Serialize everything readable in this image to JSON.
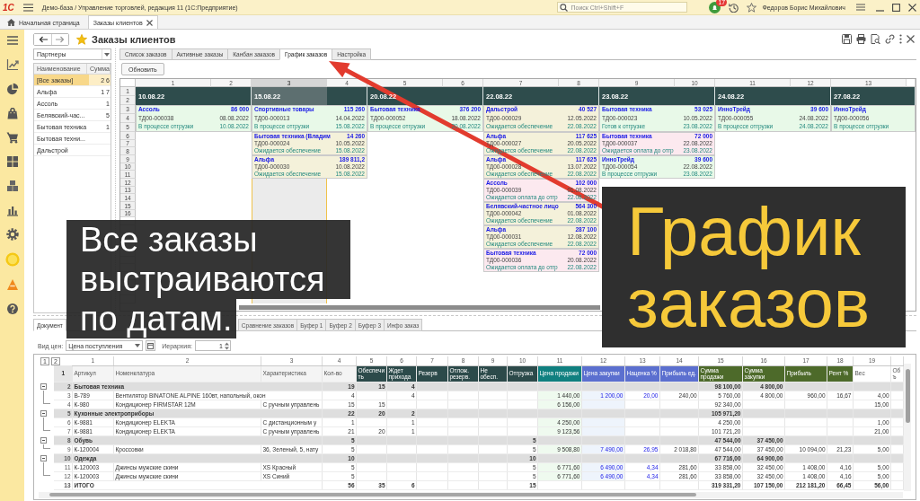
{
  "title_bar": {
    "logo": "1С",
    "title": "Демо-база / Управление торговлей, редакция 11 (1С:Предприятие)",
    "search": {
      "placeholder": "Поиск Ctrl+Shift+F"
    },
    "badge": "17",
    "user": "Федоров Борис Михайлович"
  },
  "window_tabs": [
    {
      "kind": "home",
      "label": "Начальная страница",
      "selected": false
    },
    {
      "kind": "document",
      "label": "Заказы клиентов",
      "selected": true
    }
  ],
  "form": {
    "title": "Заказы клиентов",
    "favorite": true
  },
  "partners": {
    "filter": "Партнеры",
    "columns": [
      "Наименование",
      "Сумма"
    ],
    "rows": [
      {
        "name": "[Все заказы]",
        "sum": "2 6",
        "selected": true
      },
      {
        "name": "Альфа",
        "sum": "1 7",
        "selected": false
      },
      {
        "name": "Ассоль",
        "sum": "1",
        "selected": false
      },
      {
        "name": "Белявский-час...",
        "sum": "5",
        "selected": false
      },
      {
        "name": "Бытовая техника",
        "sum": "1",
        "selected": false
      },
      {
        "name": "Бытовая техни...",
        "selected": false
      },
      {
        "name": "Дальстрой",
        "selected": false
      }
    ]
  },
  "view_tabs": [
    {
      "label": "Список заказов",
      "selected": false
    },
    {
      "label": "Активные заказы",
      "selected": false
    },
    {
      "label": "Канбан заказов",
      "selected": false
    },
    {
      "label": "График заказов",
      "selected": true
    },
    {
      "label": "Настройка",
      "selected": false
    }
  ],
  "refresh_button": "Обновить",
  "schedule": {
    "columns": [
      {
        "label": "1",
        "selected": false
      },
      {
        "label": "2",
        "selected": false
      },
      {
        "label": "3",
        "selected": true
      },
      {
        "label": "4",
        "selected": false
      },
      {
        "label": "5",
        "selected": false
      },
      {
        "label": "6",
        "selected": false
      },
      {
        "label": "7",
        "selected": false
      },
      {
        "label": "8",
        "selected": false
      },
      {
        "label": "9",
        "selected": false
      },
      {
        "label": "10",
        "selected": false
      },
      {
        "label": "11",
        "selected": false
      },
      {
        "label": "12",
        "selected": false
      },
      {
        "label": "13",
        "selected": false
      }
    ],
    "row_numbers": [
      "1",
      "2",
      "3",
      "4",
      "5",
      "6",
      "7",
      "8",
      "9",
      "10",
      "11",
      "12",
      "13",
      "14",
      "15",
      "16"
    ],
    "days": [
      {
        "date": "10.08.22",
        "orders": [
          {
            "customer": "Ассоль",
            "amount": "86 000",
            "number": "ТД00-000038",
            "date": "08.08.2022",
            "status": "В процессе отгрузки",
            "ship_date": "10.08.2022",
            "color": "#e8f9e8"
          }
        ]
      },
      {
        "date": "15.08.22",
        "orders": [
          {
            "customer": "Спортивные товары",
            "amount": "115 260",
            "number": "ТД00-000013",
            "date": "14.04.2022",
            "status": "В процессе отгрузки",
            "ship_date": "15.08.2022",
            "color": "#e8f9e8"
          },
          {
            "customer": "Бытовая техника (Владим",
            "amount": "14 260",
            "number": "ТД00-000024",
            "date": "10.05.2022",
            "status": "Ожидается обеспечение",
            "ship_date": "15.08.2022",
            "color": "#f4f1da"
          },
          {
            "customer": "Альфа",
            "amount": "189 811,2",
            "number": "ТД00-000030",
            "date": "10.08.2022",
            "status": "Ожидается обеспечение",
            "ship_date": "15.08.2022",
            "color": "#f4f1da"
          }
        ]
      },
      {
        "date": "20.08.22",
        "orders": [
          {
            "customer": "Бытовая техника",
            "amount": "376 200",
            "number": "ТД00-000052",
            "date": "18.08.2022",
            "status": "В процессе отгрузки",
            "ship_date": "20.08.2022",
            "color": "#e8f9e8"
          }
        ]
      },
      {
        "date": "22.08.22",
        "orders": [
          {
            "customer": "Дальстрой",
            "amount": "40 527",
            "number": "ТД00-000029",
            "date": "12.05.2022",
            "status": "Ожидается обеспечение",
            "ship_date": "22.08.2022",
            "color": "#f4f1da"
          },
          {
            "customer": "Альфа",
            "amount": "117 625",
            "number": "ТД00-000027",
            "date": "20.05.2022",
            "status": "Ожидается обеспечение",
            "ship_date": "22.08.2022",
            "color": "#f4f1da"
          },
          {
            "customer": "Альфа",
            "amount": "117 625",
            "number": "ТД00-000028",
            "date": "13.07.2022",
            "status": "Ожидается обеспечение",
            "ship_date": "22.08.2022",
            "color": "#f4f1da"
          },
          {
            "customer": "Ассоль",
            "amount": "102 000",
            "number": "ТД00-000039",
            "date": "01.08.2022",
            "status": "Ожидается оплата до отгр",
            "ship_date": "22.08.2022",
            "color": "#fce9ef"
          },
          {
            "customer": "Белявский-частное лицо",
            "amount": "564 300",
            "number": "ТД00-000042",
            "date": "01.08.2022",
            "status": "Ожидается обеспечение",
            "ship_date": "22.08.2022",
            "color": "#f4f1da"
          },
          {
            "customer": "Альфа",
            "amount": "287 100",
            "number": "ТД00-000031",
            "date": "12.08.2022",
            "status": "Ожидается обеспечение",
            "ship_date": "22.08.2022",
            "color": "#f4f1da"
          },
          {
            "customer": "Бытовая техника",
            "amount": "72 000",
            "number": "ТД00-000036",
            "date": "20.08.2022",
            "status": "Ожидается оплата до отгр",
            "ship_date": "22.08.2022",
            "color": "#fce9ef"
          }
        ]
      },
      {
        "date": "23.08.22",
        "orders": [
          {
            "customer": "Бытовая техника",
            "amount": "53 025",
            "number": "ТД00-000023",
            "date": "10.05.2022",
            "status": "Готов к отгрузке",
            "ship_date": "23.08.2022",
            "color": "#e8f9e8"
          },
          {
            "customer": "Бытовая техника",
            "amount": "72 000",
            "number": "ТД00-000037",
            "date": "22.08.2022",
            "status": "Ожидается оплата до отгр",
            "ship_date": "23.08.2022",
            "color": "#fce9ef"
          },
          {
            "customer": "ИнноТрейд",
            "amount": "39 600",
            "number": "ТД00-000054",
            "date": "22.08.2022",
            "status": "В процессе отгрузки",
            "ship_date": "23.08.2022",
            "color": "#e8f9e8"
          }
        ]
      },
      {
        "date": "24.08.22",
        "orders": [
          {
            "customer": "ИнноТрейд",
            "amount": "39 600",
            "number": "ТД00-000055",
            "date": "24.08.2022",
            "status": "В процессе отгрузки",
            "ship_date": "24.08.2022",
            "color": "#e8f9e8"
          }
        ]
      },
      {
        "date": "27.08.22",
        "orders": [
          {
            "customer": "ИнноТрейд",
            "number": "ТД00-000056",
            "status": "В процессе отгрузки",
            "color": "#e8f9e8"
          }
        ]
      }
    ]
  },
  "details": {
    "tabs": [
      {
        "label": "Документ",
        "selected": true
      },
      {
        "label": "Сравнение заказов",
        "selected": false
      },
      {
        "label": "Буфер 1",
        "selected": false
      },
      {
        "label": "Буфер 2",
        "selected": false
      },
      {
        "label": "Буфер 3",
        "selected": false
      },
      {
        "label": "Инфо заказ",
        "selected": false
      }
    ],
    "price_type": {
      "label": "Вид цен:",
      "value": "Цена поступления"
    },
    "hierarchy": {
      "label": "Иерархия:",
      "value": "1"
    },
    "table": {
      "levels": [
        "1",
        "2"
      ],
      "header_number": "1",
      "columns": [
        {
          "number": "1",
          "label": "Артикул",
          "color": "#f4f4f4"
        },
        {
          "number": "2",
          "label": "Номенклатура",
          "color": "#f4f4f4"
        },
        {
          "number": "3",
          "label": "Характеристика",
          "color": "#f4f4f4"
        },
        {
          "number": "4",
          "label": "Кол-во",
          "color": "#f4f4f4"
        },
        {
          "number": "5",
          "label": "Обеспечить",
          "color": "#2c4a4a"
        },
        {
          "number": "6",
          "label": "Ждет прихода",
          "color": "#2c4a4a"
        },
        {
          "number": "7",
          "label": "Резерв",
          "color": "#2c4a4a"
        },
        {
          "number": "8",
          "label": "Отлож. резерв.",
          "color": "#2c4a4a"
        },
        {
          "number": "9",
          "label": "Не обесп.",
          "color": "#2c4a4a"
        },
        {
          "number": "10",
          "label": "Отгрузка",
          "color": "#2c4a4a"
        },
        {
          "number": "11",
          "label": "Цена продажи",
          "color": "#108080"
        },
        {
          "number": "12",
          "label": "Цена закупки",
          "color": "#5b6fcf"
        },
        {
          "number": "13",
          "label": "Наценка %",
          "color": "#5b6fcf"
        },
        {
          "number": "14",
          "label": "Прибыль ед.",
          "color": "#5b6fcf"
        },
        {
          "number": "15",
          "label": "Сумма продажи",
          "color": "#4d6a2a"
        },
        {
          "number": "16",
          "label": "Сумма закупки",
          "color": "#4d6a2a"
        },
        {
          "number": "17",
          "label": "Прибыль",
          "color": "#4d6a2a"
        },
        {
          "number": "18",
          "label": "Рент %",
          "color": "#4d6a2a"
        },
        {
          "number": "19",
          "label": "Вес",
          "color": "#ffffff"
        },
        {
          "label": "Объ",
          "color": "#ffffff"
        }
      ],
      "rows": [
        {
          "number": "2",
          "kind": "group",
          "expanded": true,
          "cells": [
            {
              "text": "Бытовая техника",
              "colspan": 3
            },
            "19",
            "15",
            "4",
            null,
            null,
            null,
            null,
            null,
            null,
            null,
            null,
            "98 100,00",
            "4 800,00"
          ]
        },
        {
          "number": "3",
          "kind": "item",
          "cells": [
            "В-789",
            {
              "text": "Вентилятор BINATONE ALPINE 160вт, напольный, окон",
              "colspan": 2
            },
            "4",
            null,
            "4",
            null,
            null,
            null,
            null,
            "1 440,00",
            "1 200,00",
            "20,00",
            "240,00",
            "5 760,00",
            "4 800,00",
            "960,00",
            "16,67",
            "4,00"
          ]
        },
        {
          "number": "4",
          "kind": "item",
          "cells": [
            "К-980",
            "Кондиционер FIRMSTAR 12M",
            "С ручным управлень",
            "15",
            "15",
            null,
            null,
            null,
            null,
            null,
            "6 156,00",
            null,
            null,
            null,
            "92 340,00",
            null,
            null,
            null,
            "15,00"
          ]
        },
        {
          "number": "5",
          "kind": "group",
          "expanded": true,
          "cells": [
            {
              "text": "Кухонные электроприборы",
              "colspan": 3
            },
            "22",
            "20",
            "2",
            null,
            null,
            null,
            null,
            null,
            null,
            null,
            null,
            "105 971,20"
          ]
        },
        {
          "number": "6",
          "kind": "item",
          "cells": [
            "К-9881",
            "Кондиционер ELEKTA",
            "С дистанционным у",
            "1",
            null,
            "1",
            null,
            null,
            null,
            null,
            "4 250,00",
            null,
            null,
            null,
            "4 250,00",
            null,
            null,
            null,
            "1,00"
          ]
        },
        {
          "number": "7",
          "kind": "item",
          "cells": [
            "К-9881",
            "Кондиционер ELEKTA",
            "С ручным управлень",
            "21",
            "20",
            "1",
            null,
            null,
            null,
            null,
            "9 123,56",
            null,
            null,
            null,
            "101 721,20",
            null,
            null,
            null,
            "21,00"
          ]
        },
        {
          "number": "8",
          "kind": "group",
          "expanded": true,
          "cells": [
            {
              "text": "Обувь",
              "colspan": 3
            },
            "5",
            null,
            null,
            null,
            null,
            null,
            "5",
            null,
            null,
            null,
            null,
            "47 544,00",
            "37 450,00"
          ]
        },
        {
          "number": "9",
          "kind": "item",
          "cells": [
            "К-120004",
            "Кроссовки",
            "36, Зеленый, 5, нату",
            "5",
            null,
            null,
            null,
            null,
            null,
            "5",
            "9 508,80",
            "7 490,00",
            "26,95",
            "2 018,80",
            "47 544,00",
            "37 450,00",
            "10 094,00",
            "21,23",
            "5,00"
          ]
        },
        {
          "number": "10",
          "kind": "group",
          "expanded": true,
          "cells": [
            {
              "text": "Одежда",
              "colspan": 3
            },
            "10",
            null,
            null,
            null,
            null,
            null,
            "10",
            null,
            null,
            null,
            null,
            "67 716,00",
            "64 900,00"
          ]
        },
        {
          "number": "11",
          "kind": "item",
          "cells": [
            "К-120003",
            "Джинсы мужские скини",
            "XS Красный",
            "5",
            null,
            null,
            null,
            null,
            null,
            "5",
            "6 771,60",
            "6 490,00",
            "4,34",
            "281,60",
            "33 858,00",
            "32 450,00",
            "1 408,00",
            "4,16",
            "5,00"
          ]
        },
        {
          "number": "12",
          "kind": "item",
          "cells": [
            "К-120003",
            "Джинсы мужские скини",
            "XS Синий",
            "5",
            null,
            null,
            null,
            null,
            null,
            "5",
            "6 771,60",
            "6 490,00",
            "4,34",
            "281,60",
            "33 858,00",
            "32 450,00",
            "1 408,00",
            "4,16",
            "5,00"
          ]
        },
        {
          "number": "13",
          "kind": "total",
          "cells": [
            {
              "text": "ИТОГО",
              "colspan": 3
            },
            "56",
            "35",
            "6",
            null,
            null,
            null,
            "15",
            null,
            null,
            null,
            null,
            "319 331,20",
            "107 150,00",
            "212 181,20",
            "66,45",
            "56,00"
          ]
        }
      ]
    }
  },
  "captions": [
    {
      "kind": "note",
      "lines": [
        "Все заказы",
        "выстраиваются",
        "по датам."
      ]
    },
    {
      "kind": "headline",
      "text": "График заказов"
    }
  ]
}
